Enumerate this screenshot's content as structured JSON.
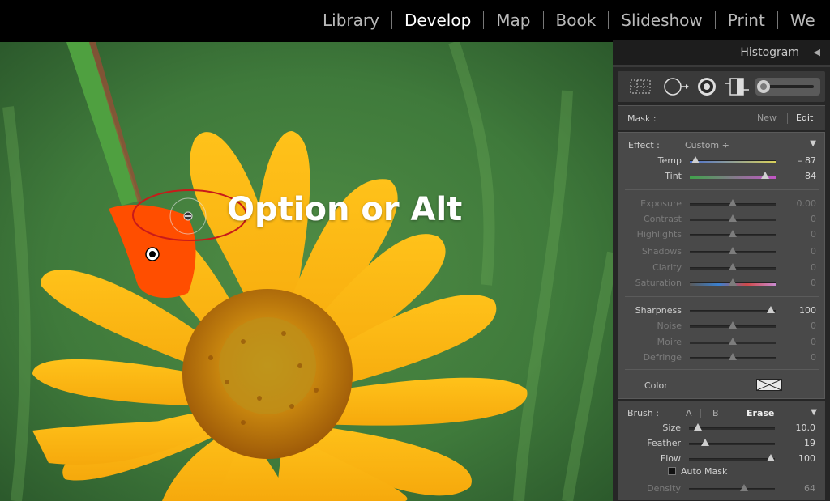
{
  "modules": [
    "Library",
    "Develop",
    "Map",
    "Book",
    "Slideshow",
    "Print",
    "We"
  ],
  "active_module": "Develop",
  "overlay_text": "Option or Alt",
  "histogram": {
    "title": "Histogram",
    "collapse_icon": "triangle-left-icon"
  },
  "tools": [
    "crop-overlay-icon",
    "spot-removal-icon",
    "red-eye-icon",
    "graduated-filter-icon",
    "adjustment-brush-icon"
  ],
  "mask": {
    "label": "Mask :",
    "new": "New",
    "edit": "Edit"
  },
  "effect": {
    "label": "Effect :",
    "preset": "Custom ÷",
    "rows": [
      {
        "name": "Temp",
        "value": "– 87",
        "level": 0.07
      },
      {
        "name": "Tint",
        "value": "84",
        "level": 0.88
      },
      {
        "name": "Exposure",
        "value": "0.00",
        "level": 0.5
      },
      {
        "name": "Contrast",
        "value": "0",
        "level": 0.5
      },
      {
        "name": "Highlights",
        "value": "0",
        "level": 0.5
      },
      {
        "name": "Shadows",
        "value": "0",
        "level": 0.5
      },
      {
        "name": "Clarity",
        "value": "0",
        "level": 0.5
      },
      {
        "name": "Saturation",
        "value": "0",
        "level": 0.5
      },
      {
        "name": "Sharpness",
        "value": "100",
        "level": 0.94
      },
      {
        "name": "Noise",
        "value": "0",
        "level": 0.5
      },
      {
        "name": "Moire",
        "value": "0",
        "level": 0.5
      },
      {
        "name": "Defringe",
        "value": "0",
        "level": 0.5
      }
    ],
    "color_label": "Color"
  },
  "brush": {
    "label": "Brush :",
    "a": "A",
    "b": "B",
    "erase": "Erase",
    "rows": [
      {
        "name": "Size",
        "value": "10.0",
        "level": 0.1
      },
      {
        "name": "Feather",
        "value": "19",
        "level": 0.19
      },
      {
        "name": "Flow",
        "value": "100",
        "level": 0.95
      },
      {
        "name": "Density",
        "value": "64",
        "level": 0.64
      }
    ],
    "auto_mask": "Auto Mask"
  },
  "colors": {
    "background": "#000000",
    "panel": "#262626",
    "mask_overlay": "#ff4e00",
    "annotation_ring": "#c81a1a"
  }
}
